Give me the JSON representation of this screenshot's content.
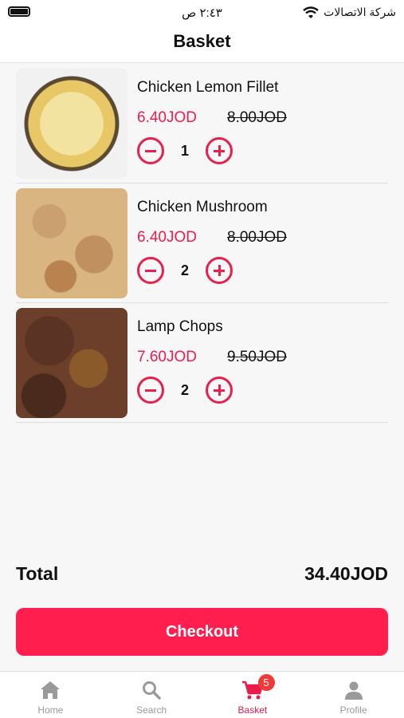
{
  "status_bar": {
    "time": "٢:٤٣ ص",
    "carrier": "شركة الاتصالات"
  },
  "header": {
    "title": "Basket"
  },
  "basket": {
    "items": [
      {
        "name": "Chicken Lemon Fillet",
        "price": "6.40JOD",
        "original_price": "8.00JOD",
        "quantity": "1"
      },
      {
        "name": "Chicken Mushroom",
        "price": "6.40JOD",
        "original_price": "8.00JOD",
        "quantity": "2"
      },
      {
        "name": "Lamp Chops",
        "price": "7.60JOD",
        "original_price": "9.50JOD",
        "quantity": "2"
      }
    ]
  },
  "summary": {
    "total_label": "Total",
    "total_value": "34.40JOD"
  },
  "checkout": {
    "label": "Checkout"
  },
  "tab_bar": {
    "tabs": [
      {
        "label": "Home",
        "icon": "home-icon"
      },
      {
        "label": "Search",
        "icon": "search-icon"
      },
      {
        "label": "Basket",
        "icon": "cart-icon",
        "badge": "5"
      },
      {
        "label": "Profile",
        "icon": "person-icon"
      }
    ],
    "active_index": 2
  },
  "colors": {
    "accent": "#ff1e4d",
    "price": "#f01e4f",
    "inactive": "#9a9a9a"
  }
}
